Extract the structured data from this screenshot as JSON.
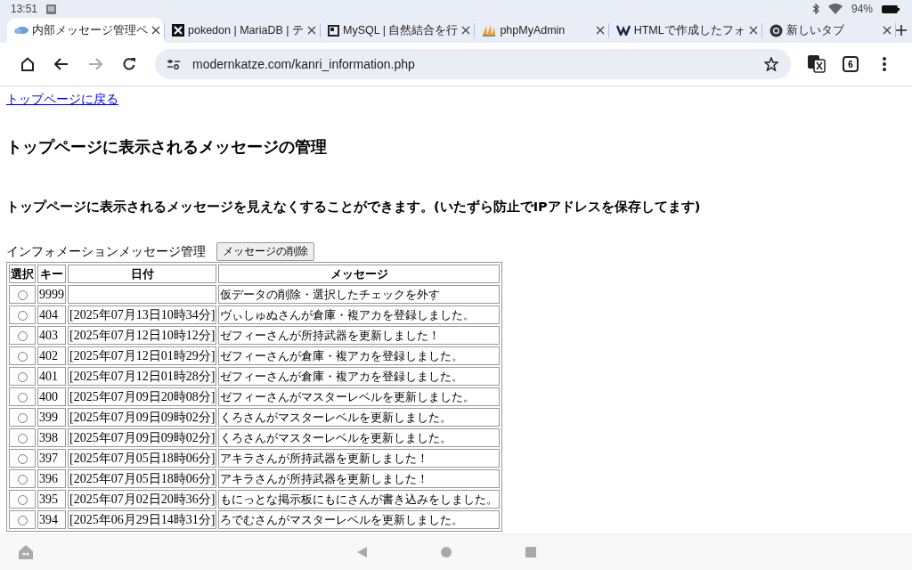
{
  "status_bar": {
    "time": "13:51",
    "battery": "94%"
  },
  "tabs": [
    {
      "title": "内部メッセージ管理ペ",
      "selected": true
    },
    {
      "title": "pokedon | MariaDB | テ",
      "selected": false
    },
    {
      "title": "MySQL | 自然結合を行",
      "selected": false
    },
    {
      "title": "phpMyAdmin",
      "selected": false
    },
    {
      "title": "HTMLで作成したフォ",
      "selected": false
    },
    {
      "title": "新しいタブ",
      "selected": false
    }
  ],
  "toolbar": {
    "url": "modernkatze.com/kanri_information.php",
    "tab_count": "6"
  },
  "page": {
    "back_link": "トップページに戻る",
    "heading": "トップページに表示されるメッセージの管理",
    "subheading": "トップページに表示されるメッセージを見えなくすることができます。(いたずら防止でIPアドレスを保存してます)",
    "form_label": "インフォメーションメッセージ管理",
    "delete_button": "メッセージの削除",
    "table": {
      "columns": [
        "選択",
        "キー",
        "日付",
        "メッセージ"
      ],
      "rows": [
        {
          "selected": false,
          "key": "9999",
          "date": "",
          "message": "仮データの削除・選択したチェックを外す"
        },
        {
          "selected": false,
          "key": "404",
          "date": "[2025年07月13日10時34分]",
          "message": "ヴぃしゅぬさんが倉庫・複アカを登録しました。"
        },
        {
          "selected": false,
          "key": "403",
          "date": "[2025年07月12日10時12分]",
          "message": "ゼフィーさんが所持武器を更新しました！"
        },
        {
          "selected": false,
          "key": "402",
          "date": "[2025年07月12日01時29分]",
          "message": "ゼフィーさんが倉庫・複アカを登録しました。"
        },
        {
          "selected": false,
          "key": "401",
          "date": "[2025年07月12日01時28分]",
          "message": "ゼフィーさんが倉庫・複アカを登録しました。"
        },
        {
          "selected": false,
          "key": "400",
          "date": "[2025年07月09日20時08分]",
          "message": "ゼフィーさんがマスターレベルを更新しました。"
        },
        {
          "selected": false,
          "key": "399",
          "date": "[2025年07月09日09時02分]",
          "message": "くろさんがマスターレベルを更新しました。"
        },
        {
          "selected": false,
          "key": "398",
          "date": "[2025年07月09日09時02分]",
          "message": "くろさんがマスターレベルを更新しました。"
        },
        {
          "selected": false,
          "key": "397",
          "date": "[2025年07月05日18時06分]",
          "message": "アキラさんが所持武器を更新しました！"
        },
        {
          "selected": false,
          "key": "396",
          "date": "[2025年07月05日18時06分]",
          "message": "アキラさんが所持武器を更新しました！"
        },
        {
          "selected": false,
          "key": "395",
          "date": "[2025年07月02日20時36分]",
          "message": "もにっとな掲示板にもにさんが書き込みをしました。"
        },
        {
          "selected": false,
          "key": "394",
          "date": "[2025年06月29日14時31分]",
          "message": "ろでむさんがマスターレベルを更新しました。"
        }
      ]
    }
  }
}
